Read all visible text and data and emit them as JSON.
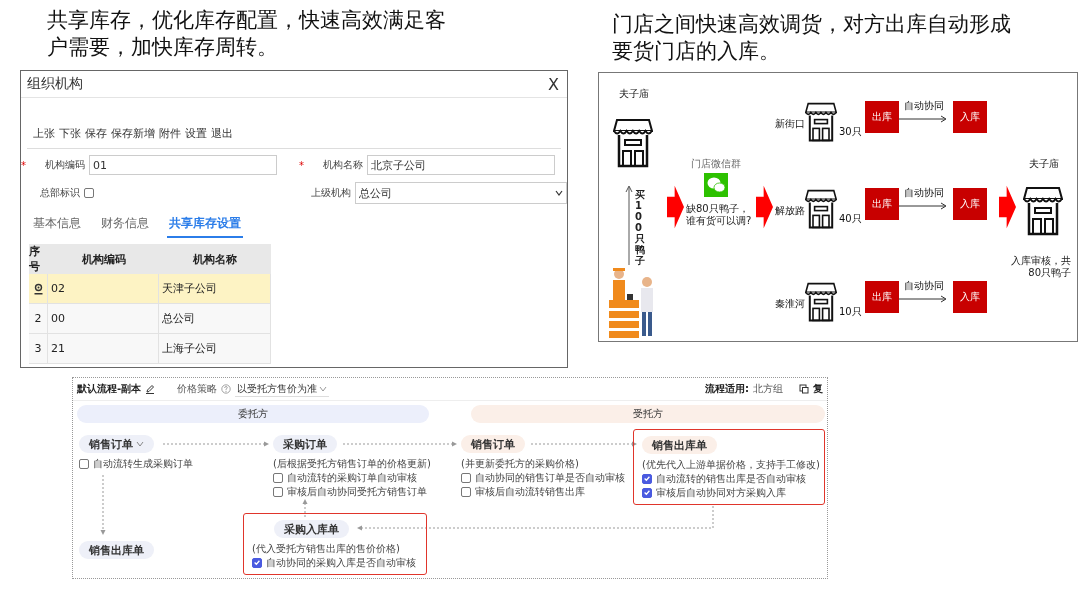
{
  "captions": [
    "共享库存，优化库存配置，快速高效满足客户需要，加快库存周转。",
    "门店之间快速高效调货，对方出库自动形成要货门店的入库。"
  ],
  "org_window": {
    "title": "组织机构",
    "close": "X",
    "toolbar": [
      "上张",
      "下张",
      "保存",
      "保存新增",
      "附件",
      "设置",
      "退出"
    ],
    "code_field": {
      "required_mark": "*",
      "label": "机构编码",
      "value": "01"
    },
    "name_field": {
      "required_mark": "*",
      "label": "机构名称",
      "value": "北京子公司"
    },
    "hq_flag": {
      "label": "总部标识",
      "checked": false
    },
    "parent_field": {
      "label": "上级机构",
      "value": "总公司"
    },
    "tabs": [
      {
        "label": "基本信息",
        "selected": false
      },
      {
        "label": "财务信息",
        "selected": false
      },
      {
        "label": "共享库存设置",
        "selected": true
      }
    ],
    "table": {
      "columns": [
        "序号",
        "机构编码",
        "机构名称"
      ],
      "rows": [
        {
          "selected": true,
          "code": "02",
          "name": "天津子公司"
        },
        {
          "selected": false,
          "number": "2",
          "code": "00",
          "name": "总公司"
        },
        {
          "selected": false,
          "number": "3",
          "code": "21",
          "name": "上海子公司"
        }
      ]
    }
  },
  "transfer_diagram": {
    "source_store": "夫子庙",
    "purchase_note": "买100只鸭子",
    "group_name": "门店微信群",
    "group_message": "缺80只鸭子，谁有货可以调?",
    "branches": [
      {
        "store": "新街口",
        "quantity": "30只",
        "out_label": "出库",
        "sync_label": "自动协同",
        "in_label": "入库"
      },
      {
        "store": "解放路",
        "quantity": "40只",
        "out_label": "出库",
        "sync_label": "自动协同",
        "in_label": "入库"
      },
      {
        "store": "秦淮河",
        "quantity": "10只",
        "out_label": "出库",
        "sync_label": "自动协同",
        "in_label": "入库"
      }
    ],
    "target_store": "夫子庙",
    "target_note": "入库审核，共80只鸭子"
  },
  "flow_window": {
    "title": "默认流程-副本",
    "price_label": "价格策略",
    "price_value": "以受托方售价为准",
    "scope_label": "流程适用:",
    "scope_value": "北方组",
    "copy_label": "复",
    "bands": [
      {
        "label": "委托方",
        "kind": "principal"
      },
      {
        "label": "受托方",
        "kind": "agent"
      }
    ],
    "nodes": [
      {
        "title": "销售订单",
        "dropdown": true,
        "highlighted": false,
        "options": [
          {
            "label": "自动流转生成采购订单",
            "checked": false
          }
        ]
      },
      {
        "title": "采购订单",
        "dropdown": false,
        "highlighted": false,
        "note": "(后根据受托方销售订单的价格更新)",
        "options": [
          {
            "label": "自动流转的采购订单自动审核",
            "checked": false
          },
          {
            "label": "审核后自动协同受托方销售订单",
            "checked": false
          }
        ]
      },
      {
        "title": "销售订单",
        "dropdown": false,
        "highlighted": false,
        "note": "(并更新委托方的采购价格)",
        "options": [
          {
            "label": "自动协同的销售订单是否自动审核",
            "checked": false
          },
          {
            "label": "审核后自动流转销售出库",
            "checked": false
          }
        ]
      },
      {
        "title": "销售出库单",
        "dropdown": false,
        "highlighted": true,
        "note": "(优先代入上游单据价格，支持手工修改)",
        "options": [
          {
            "label": "自动流转的销售出库是否自动审核",
            "checked": true
          },
          {
            "label": "审核后自动协同对方采购入库",
            "checked": true
          }
        ]
      },
      {
        "title": "销售出库单",
        "dropdown": false,
        "highlighted": false
      },
      {
        "title": "采购入库单",
        "dropdown": false,
        "highlighted": true,
        "note": "(代入受托方销售出库的售价价格)",
        "options": [
          {
            "label": "自动协同的采购入库是否自动审核",
            "checked": true
          }
        ]
      }
    ]
  }
}
